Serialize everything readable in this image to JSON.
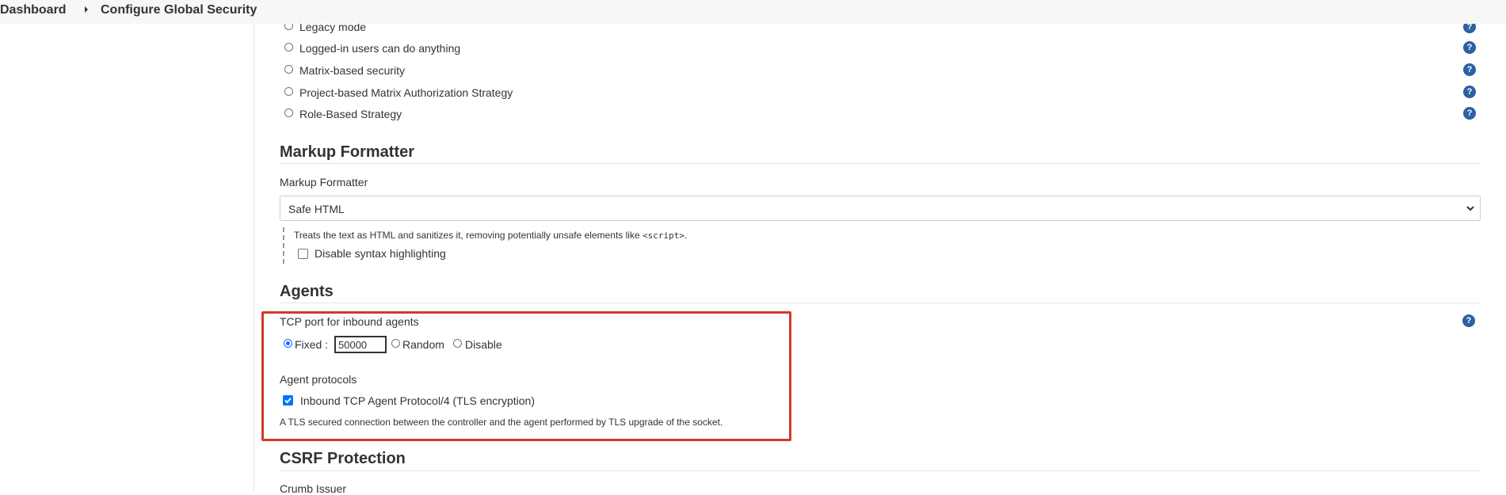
{
  "breadcrumb": {
    "items": [
      "Dashboard",
      "Configure Global Security"
    ]
  },
  "authorization": {
    "options": [
      "Legacy mode",
      "Logged-in users can do anything",
      "Matrix-based security",
      "Project-based Matrix Authorization Strategy",
      "Role-Based Strategy"
    ]
  },
  "help_glyph": "?",
  "markup_formatter": {
    "title": "Markup Formatter",
    "field_label": "Markup Formatter",
    "selected": "Safe HTML",
    "description_prefix": "Treats the text as HTML and sanitizes it, removing potentially unsafe elements like ",
    "description_code": "<script>",
    "description_suffix": ".",
    "disable_syntax_label": "Disable syntax highlighting",
    "disable_syntax_checked": false
  },
  "agents": {
    "title": "Agents",
    "tcp_port_label": "TCP port for inbound agents",
    "fixed_label": "Fixed :",
    "port_value": "50000",
    "random_label": "Random",
    "disable_label": "Disable",
    "selected_mode": "Fixed",
    "protocols_label": "Agent protocols",
    "protocol_name": "Inbound TCP Agent Protocol/4 (TLS encryption)",
    "protocol_checked": true,
    "protocol_description": "A TLS secured connection between the controller and the agent performed by TLS upgrade of the socket."
  },
  "csrf": {
    "title": "CSRF Protection",
    "crumb_issuer_label": "Crumb Issuer"
  },
  "colors": {
    "highlight": "#d33a27",
    "help_icon": "#2a61a3",
    "accent": "#0075ff"
  }
}
